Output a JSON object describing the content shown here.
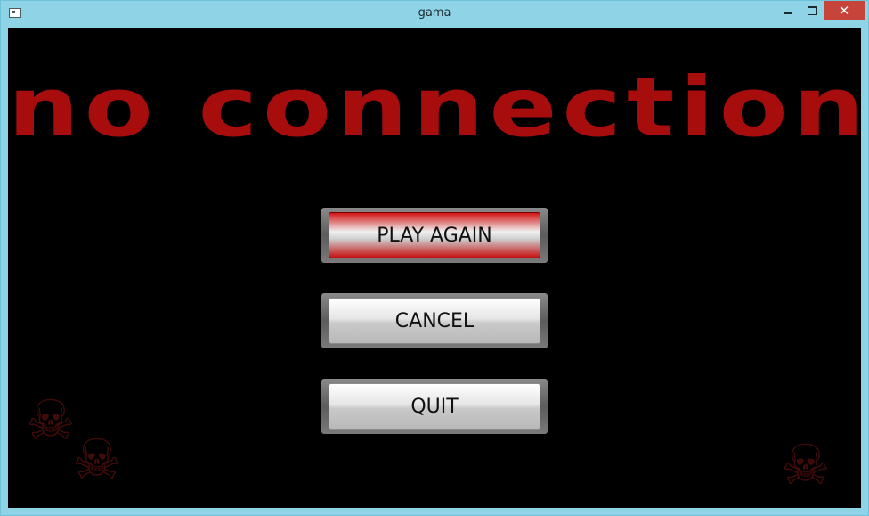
{
  "window": {
    "title": "gama",
    "close_glyph": "✕"
  },
  "screen": {
    "headline": "no connection",
    "skull_glyph": "☠"
  },
  "menu": {
    "play_again": "PLAY AGAIN",
    "cancel": "CANCEL",
    "quit": "QUIT"
  },
  "colors": {
    "title_bar": "#8ed3e6",
    "headline": "#a80d0d",
    "background": "#000000",
    "close_button": "#c7443a"
  },
  "icons": [
    "app-icon",
    "minimize-icon",
    "maximize-icon",
    "close-icon",
    "skull-icon"
  ]
}
